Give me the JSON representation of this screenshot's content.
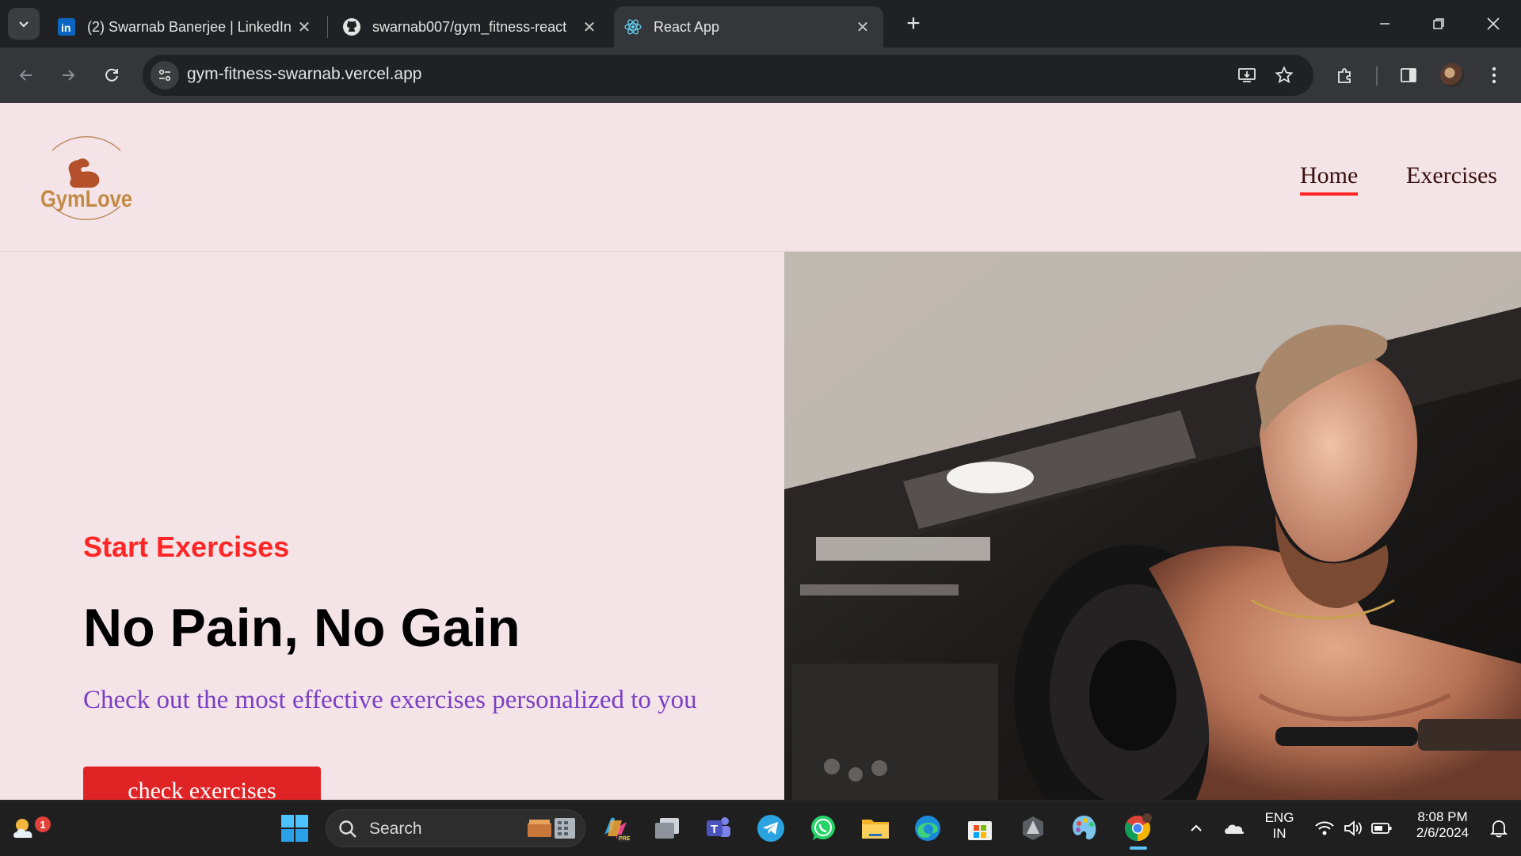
{
  "browser": {
    "tabs": [
      {
        "title": "(2) Swarnab Banerjee | LinkedIn",
        "icon": "linkedin-icon",
        "active": false
      },
      {
        "title": "swarnab007/gym_fitness-react:",
        "icon": "github-icon",
        "active": false
      },
      {
        "title": "React App",
        "icon": "react-icon",
        "active": true
      }
    ],
    "url": "gym-fitness-swarnab.vercel.app"
  },
  "site": {
    "logo_text": "GymLove",
    "nav": {
      "home": "Home",
      "exercises": "Exercises"
    },
    "hero": {
      "eyebrow": "Start Exercises",
      "title": "No Pain, No Gain",
      "subtitle": "Check out the most effective exercises personalized to you",
      "cta": "check exercises"
    }
  },
  "taskbar": {
    "weather_badge": "1",
    "search_placeholder": "Search",
    "language": "ENG",
    "region": "IN",
    "time": "8:08 PM",
    "date": "2/6/2024"
  },
  "colors": {
    "accent": "#ff2625",
    "page_bg": "#f4e4e8",
    "subtitle": "#7b3fc4"
  }
}
